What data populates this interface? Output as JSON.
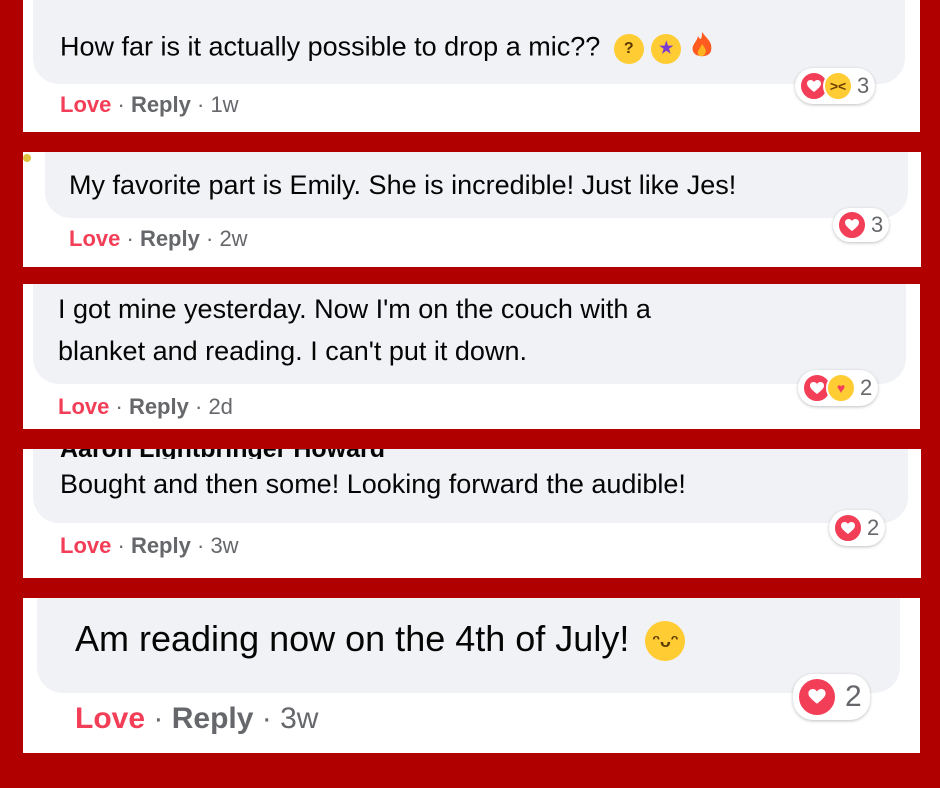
{
  "colors": {
    "background": "#b00000",
    "bubble": "#f0f2f5",
    "love": "#f33e58",
    "meta": "#65676b",
    "text": "#050505"
  },
  "separator": "·",
  "comments": [
    {
      "text": "How far is it actually possible to drop a mic??",
      "inline_emojis": [
        "thinking-face-emoji",
        "star-struck-emoji",
        "fire-emoji"
      ],
      "love_label": "Love",
      "reply_label": "Reply",
      "time": "1w",
      "reactions": [
        "heart",
        "laughing"
      ],
      "reaction_count": "3"
    },
    {
      "text": "My favorite part is Emily. She is incredible! Just like Jes!",
      "love_label": "Love",
      "reply_label": "Reply",
      "time": "2w",
      "reactions": [
        "heart"
      ],
      "reaction_count": "3"
    },
    {
      "text_line1": "I got mine yesterday. Now I'm on the couch with a",
      "text_line2": "blanket and reading. I can't put it down.",
      "love_label": "Love",
      "reply_label": "Reply",
      "time": "2d",
      "reactions": [
        "heart",
        "hugging"
      ],
      "reaction_count": "2"
    },
    {
      "author_partial": "Aaron Lightbringer Howard",
      "text": "Bought and then some! Looking forward the audible!",
      "love_label": "Love",
      "reply_label": "Reply",
      "time": "3w",
      "reactions": [
        "heart"
      ],
      "reaction_count": "2"
    },
    {
      "text": "Am reading now on the 4th of July!",
      "inline_emojis": [
        "grinning-face-emoji"
      ],
      "love_label": "Love",
      "reply_label": "Reply",
      "time": "3w",
      "reactions": [
        "heart"
      ],
      "reaction_count": "2"
    }
  ]
}
